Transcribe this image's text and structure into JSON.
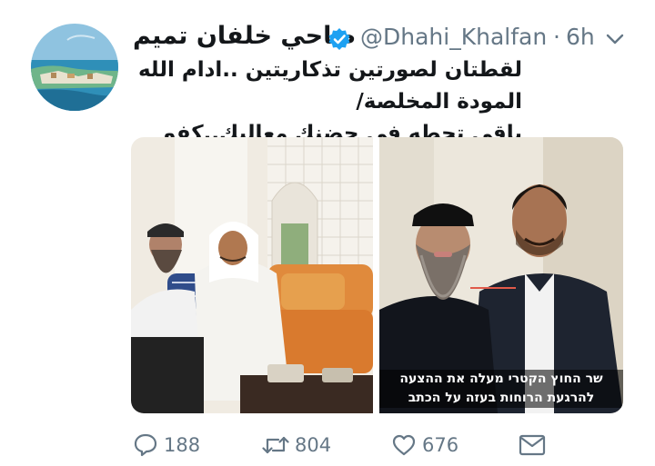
{
  "tweet": {
    "display_name": "ضاحي خلفان تميم",
    "handle": "@Dhahi_Khalfan",
    "separator": "·",
    "time": "6h",
    "verified": true,
    "text_line1": "لقطتان لصورتين تذكاريتين ..ادام الله المودة المخلصة/",
    "text_line2": "باقي تحطه في حضنك معاليك..كفو"
  },
  "media": {
    "subtitle_line1": "שר החוץ הקטרי מעלה את ההצעה",
    "subtitle_line2": "להרגעת הרוחות בעזה על הכתב"
  },
  "actions": {
    "reply_count": "188",
    "retweet_count": "804",
    "like_count": "676"
  },
  "colors": {
    "accent": "#1da1f2",
    "muted": "#657786",
    "text": "#14171a"
  },
  "icons": [
    "verified-icon",
    "caret-down-icon",
    "reply-icon",
    "retweet-icon",
    "like-icon",
    "direct-message-icon"
  ]
}
